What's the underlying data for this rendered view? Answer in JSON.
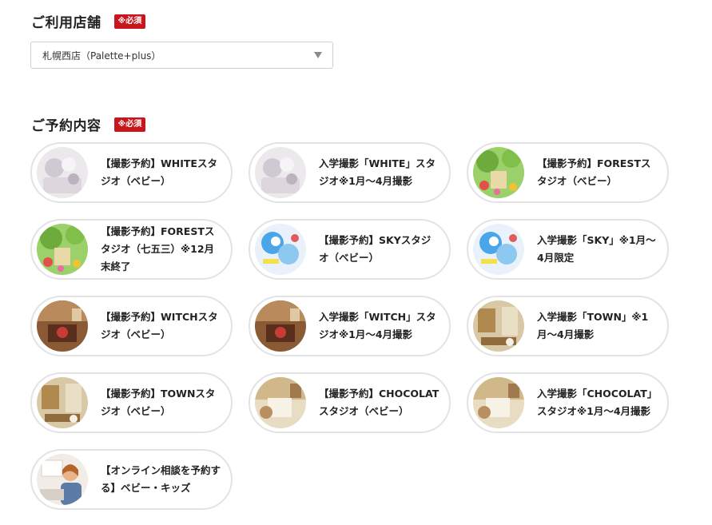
{
  "store": {
    "title": "ご利用店舗",
    "required": "※必須",
    "selected": "札幌西店（Palette+plus）"
  },
  "reservation": {
    "title": "ご予約内容",
    "required": "※必須",
    "options": [
      {
        "label": "【撮影予約】WHITEスタジオ（ベビー）",
        "thumb": "white"
      },
      {
        "label": "入学撮影「WHITE」スタジオ※1月〜4月撮影",
        "thumb": "white"
      },
      {
        "label": "【撮影予約】FORESTスタジオ（ベビー）",
        "thumb": "forest"
      },
      {
        "label": "【撮影予約】FORESTスタジオ（七五三）※12月末終了",
        "thumb": "forest"
      },
      {
        "label": "【撮影予約】SKYスタジオ（ベビー）",
        "thumb": "sky"
      },
      {
        "label": "入学撮影「SKY」※1月〜4月限定",
        "thumb": "sky"
      },
      {
        "label": "【撮影予約】WITCHスタジオ（ベビー）",
        "thumb": "witch"
      },
      {
        "label": "入学撮影「WITCH」スタジオ※1月〜4月撮影",
        "thumb": "witch"
      },
      {
        "label": "入学撮影「TOWN」※1月〜4月撮影",
        "thumb": "town"
      },
      {
        "label": "【撮影予約】TOWNスタジオ（ベビー）",
        "thumb": "town"
      },
      {
        "label": "【撮影予約】CHOCOLATスタジオ（ベビー）",
        "thumb": "chocolat"
      },
      {
        "label": "入学撮影「CHOCOLAT」スタジオ※1月〜4月撮影",
        "thumb": "chocolat"
      },
      {
        "label": "【オンライン相談を予約する】ベビー・キッズ",
        "thumb": "online"
      }
    ]
  }
}
